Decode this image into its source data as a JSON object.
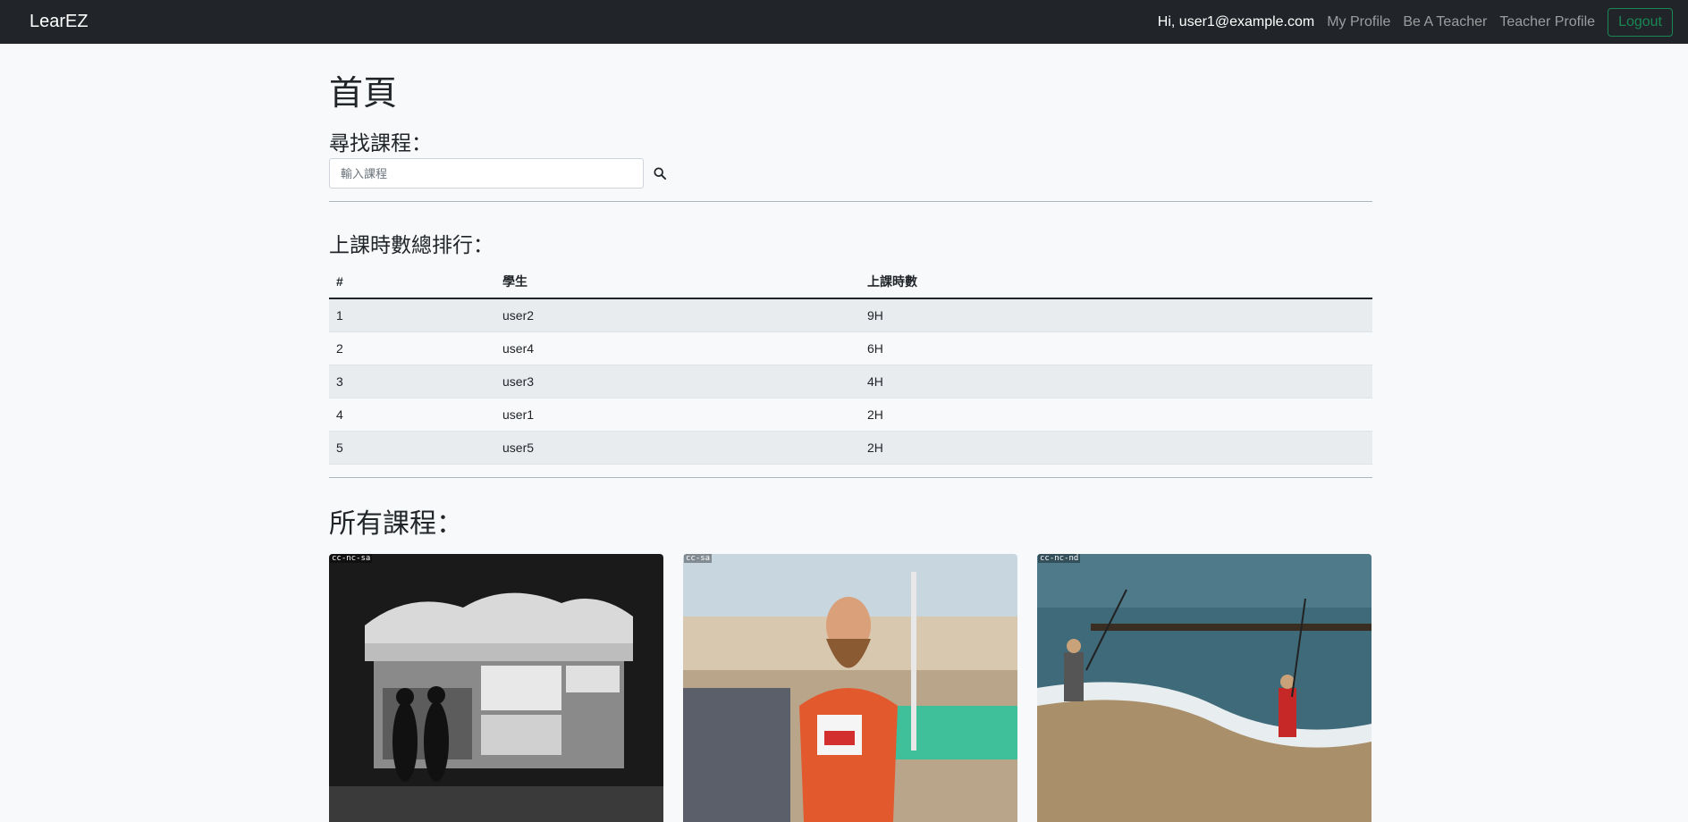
{
  "nav": {
    "brand": "LearEZ",
    "greeting": "Hi, user1@example.com",
    "links": [
      "My Profile",
      "Be A Teacher",
      "Teacher Profile"
    ],
    "logout": "Logout"
  },
  "page": {
    "title": "首頁",
    "search_label": "尋找課程：",
    "search_placeholder": "輸入課程",
    "ranking_label": "上課時數總排行：",
    "courses_label": "所有課程："
  },
  "ranking": {
    "headers": [
      "#",
      "學生",
      "上課時數"
    ],
    "rows": [
      [
        "1",
        "user2",
        "9H"
      ],
      [
        "2",
        "user4",
        "6H"
      ],
      [
        "3",
        "user3",
        "4H"
      ],
      [
        "4",
        "user1",
        "2H"
      ],
      [
        "5",
        "user5",
        "2H"
      ]
    ]
  },
  "courses": [
    {
      "license": "cc-nc-sa",
      "icon": "snack-stand-photo"
    },
    {
      "license": "cc-sa",
      "icon": "runner-photo"
    },
    {
      "license": "cc-nc-nd",
      "icon": "beach-fishing-photo"
    }
  ],
  "colors": {
    "navbar": "#212529",
    "logout": "#198754",
    "stripe": "#e9ecef"
  }
}
